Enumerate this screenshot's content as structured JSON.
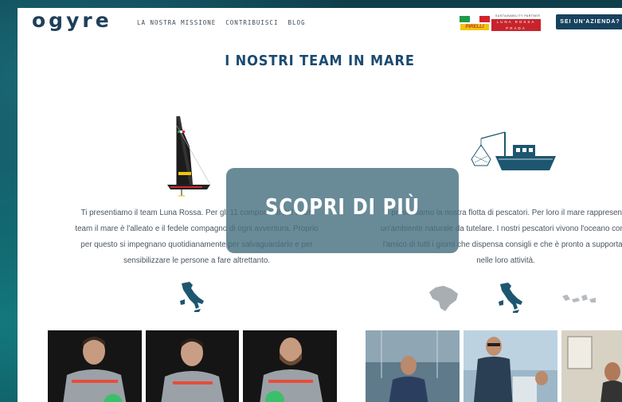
{
  "brand": {
    "logo": "ogyre"
  },
  "nav": {
    "items": [
      "LA NOSTRA MISSIONE",
      "CONTRIBUISCI",
      "BLOG"
    ]
  },
  "partner": {
    "caption": "SUSTAINABILITY PARTNER",
    "pirelli": "PIRELLI",
    "luna_rossa": "LUNA ROSSA",
    "prada": "PRADA"
  },
  "header": {
    "cta_label": "SEI UN'AZIENDA?"
  },
  "main": {
    "title": "I NOSTRI TEAM IN MARE",
    "left_text_lines": [
      "Ti presentiamo il team Luna Rossa. Per gli 11 componenti del team",
      "team il mare è l'alleato e il fedele compagno di ogni avventura. Proprio",
      "per questo si impegnano quotidianamente per salvaguardarlo e per",
      "sensibilizzare le persone a fare altrettanto."
    ],
    "right_text_lines": [
      "Ti presentiamo la nostra flotta di pescatori. Per loro il mare rappresenta",
      "un'ambiente naturale da tutelare. I nostri pescatori vivono l'oceano come",
      "l'amico di tutti i giorni che dispensa consigli e che è pronto a supportarli",
      "nelle loro attività."
    ]
  },
  "overlay": {
    "label": "SCOPRI DI PIÙ"
  },
  "colors": {
    "brand_navy": "#1b4a70",
    "cta_bg": "#17425e",
    "overlay_bg": "#487080",
    "luna_red": "#c8232c",
    "pirelli_yellow": "#f1c40f",
    "map_blue": "#1d5670"
  },
  "icons": [
    "italy-map-icon",
    "brazil-map-icon",
    "indonesia-map-icon",
    "sailboat-illustration",
    "fishing-boat-illustration"
  ]
}
